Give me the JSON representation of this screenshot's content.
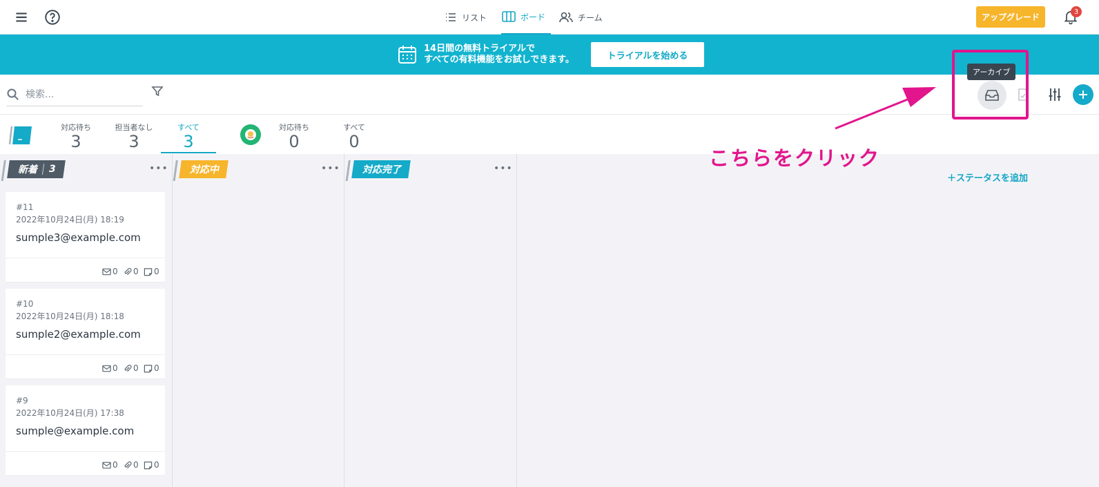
{
  "topbar": {
    "nav": [
      {
        "label": "リスト",
        "icon": "list-icon",
        "active": false
      },
      {
        "label": "ボード",
        "icon": "board-icon",
        "active": true
      },
      {
        "label": "チーム",
        "icon": "team-icon",
        "active": false
      }
    ],
    "upgrade_label": "アップグレード",
    "notification_count": "3"
  },
  "banner": {
    "line1": "14日間の無料トライアルで",
    "line2": "すべての有料機能をお試しできます。",
    "cta_label": "トライアルを始める",
    "color": "#12b3cf"
  },
  "toolbar": {
    "search_placeholder": "検索...",
    "archive_tooltip": "アーカイブ"
  },
  "stats": {
    "team": [
      {
        "label": "対応待ち",
        "value": "3"
      },
      {
        "label": "担当者なし",
        "value": "3"
      },
      {
        "label": "すべて",
        "value": "3",
        "active": true
      }
    ],
    "user": [
      {
        "label": "対応待ち",
        "value": "0"
      },
      {
        "label": "すべて",
        "value": "0"
      }
    ]
  },
  "board": {
    "columns": [
      {
        "title": "新着",
        "count": "3",
        "color": "#4f5b66"
      },
      {
        "title": "対応中",
        "color": "#f7b52c"
      },
      {
        "title": "対応完了",
        "color": "#14aac8"
      }
    ],
    "cards": [
      {
        "id": "#11",
        "date": "2022年10月24日(月) 18:19",
        "email": "sumple3@example.com",
        "mails": "0",
        "attachments": "0",
        "notes": "0"
      },
      {
        "id": "#10",
        "date": "2022年10月24日(月) 18:18",
        "email": "sumple2@example.com",
        "mails": "0",
        "attachments": "0",
        "notes": "0"
      },
      {
        "id": "#9",
        "date": "2022年10月24日(月) 17:38",
        "email": "sumple@example.com",
        "mails": "0",
        "attachments": "0",
        "notes": "0"
      }
    ],
    "add_status_label": "＋ステータスを追加",
    "more_label": "•••"
  },
  "annotation": {
    "text": "こちらをクリック",
    "color": "#e2158c"
  }
}
